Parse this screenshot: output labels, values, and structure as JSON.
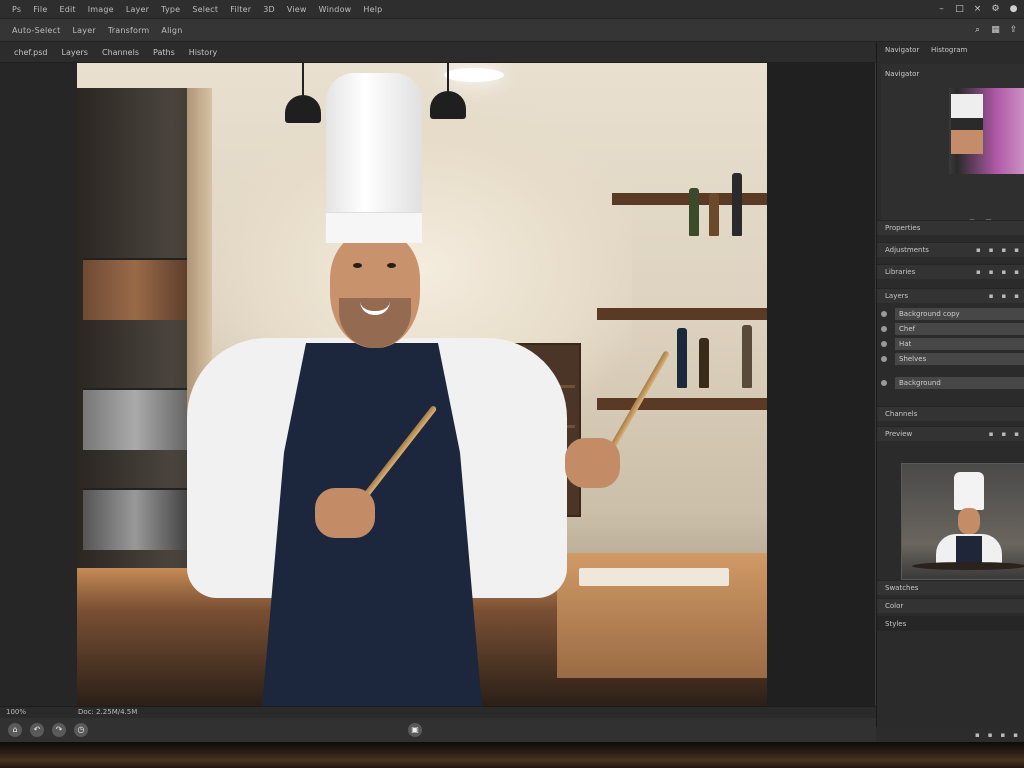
{
  "menubar": {
    "items": [
      "Ps",
      "File",
      "Edit",
      "Image",
      "Layer",
      "Type",
      "Select",
      "Filter",
      "3D",
      "View",
      "Window",
      "Help"
    ],
    "right_icons": [
      "minimize-icon",
      "restore-icon",
      "close-icon",
      "settings-icon",
      "user-icon"
    ]
  },
  "toolbar": {
    "items": [
      "Auto-Select",
      "Layer",
      "Transform",
      "Align"
    ],
    "right_icons": [
      "search-icon",
      "workspace-icon",
      "share-icon"
    ]
  },
  "tabbar": {
    "items": [
      "chef.psd",
      "Layers",
      "Channels",
      "Paths",
      "History"
    ]
  },
  "panel": {
    "tabs": [
      "Navigator",
      "Histogram"
    ],
    "navigator_label": "Navigator",
    "zoom_icons": [
      "zoom-out-icon",
      "zoom-slider-icon",
      "zoom-in-icon",
      "fit-icon",
      "fill-icon"
    ],
    "sections": [
      {
        "label": "Properties"
      },
      {
        "label": "Adjustments"
      },
      {
        "label": "Libraries"
      },
      {
        "label": "Layers"
      }
    ],
    "layers": [
      "Background copy",
      "Chef",
      "Hat",
      "Shelves",
      "Background"
    ],
    "section_footer": "Channels",
    "preview_label": "Preview",
    "lower_labels": [
      "Swatches",
      "Color",
      "Styles"
    ]
  },
  "statusbar": {
    "left": "100%",
    "doc": "Doc: 2.25M/4.5M"
  },
  "bottombar": {
    "buttons": [
      "home-icon",
      "undo-icon",
      "redo-icon",
      "history-icon"
    ],
    "center_icon": "camera-icon"
  },
  "colors": {
    "app_bg": "#3b3b3b",
    "panel_bg": "#2b2b2b",
    "menubar_bg": "#2e2e2e",
    "accent": "#b15aa8"
  }
}
